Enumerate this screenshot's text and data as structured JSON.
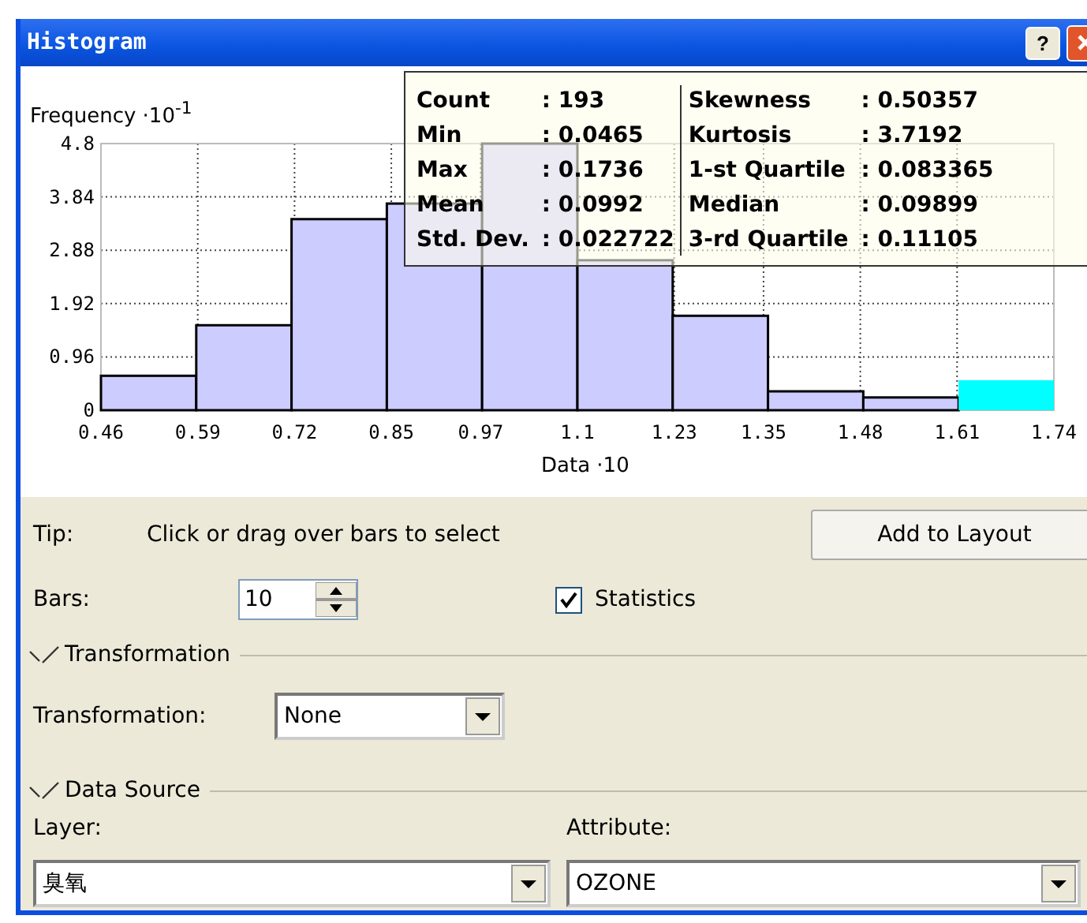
{
  "window": {
    "title": "Histogram",
    "help_button": "?"
  },
  "chart_data": {
    "type": "bar",
    "ylabel": "Frequency ·10$^{-1}$",
    "xlabel": "Data ·10",
    "grid": true,
    "x": [
      0.524,
      0.652,
      0.78,
      0.908,
      1.036,
      1.164,
      1.292,
      1.42,
      1.548,
      1.676
    ],
    "xticks": [
      0.46,
      0.59,
      0.72,
      0.85,
      0.97,
      1.1,
      1.23,
      1.35,
      1.48,
      1.61,
      1.74
    ],
    "yticks": [
      0,
      0.96,
      1.92,
      2.88,
      3.84,
      4.8
    ],
    "ylim": [
      0,
      4.8
    ],
    "xlim": [
      0.46,
      1.74
    ],
    "series": [
      {
        "color": "#ccccff",
        "values": [
          0.62,
          1.53,
          3.44,
          3.72,
          4.8,
          2.7,
          1.7,
          0.34,
          0.23,
          null
        ]
      },
      {
        "color": "#00ffff",
        "values": [
          null,
          null,
          null,
          null,
          null,
          null,
          null,
          null,
          null,
          0.54
        ]
      }
    ]
  },
  "statistics": {
    "left": [
      {
        "label": "Count",
        "value": ": 193"
      },
      {
        "label": "Min",
        "value": ": 0.0465"
      },
      {
        "label": "Max",
        "value": ": 0.1736"
      },
      {
        "label": "Mean",
        "value": ": 0.0992"
      },
      {
        "label": "Std. Dev.",
        "value": ": 0.022722"
      }
    ],
    "right": [
      {
        "label": "Skewness",
        "value": ": 0.50357"
      },
      {
        "label": "Kurtosis",
        "value": ": 3.7192"
      },
      {
        "label": "1-st Quartile",
        "value": ": 0.083365"
      },
      {
        "label": "Median",
        "value": ": 0.09899"
      },
      {
        "label": "3-rd Quartile",
        "value": ": 0.11105"
      }
    ]
  },
  "tip": {
    "label": "Tip:",
    "text": "Click or drag over bars to select"
  },
  "add_to_layout_button": "Add to Layout",
  "bars_field": {
    "label": "Bars:",
    "value": "10"
  },
  "statistics_checkbox": {
    "label": "Statistics",
    "checked": true
  },
  "transformation_group": {
    "title": "Transformation",
    "label": "Transformation:",
    "value": "None"
  },
  "data_source_group": {
    "title": "Data Source",
    "layer_label": "Layer:",
    "layer_value": "臭氧",
    "attribute_label": "Attribute:",
    "attribute_value": "OZONE"
  }
}
